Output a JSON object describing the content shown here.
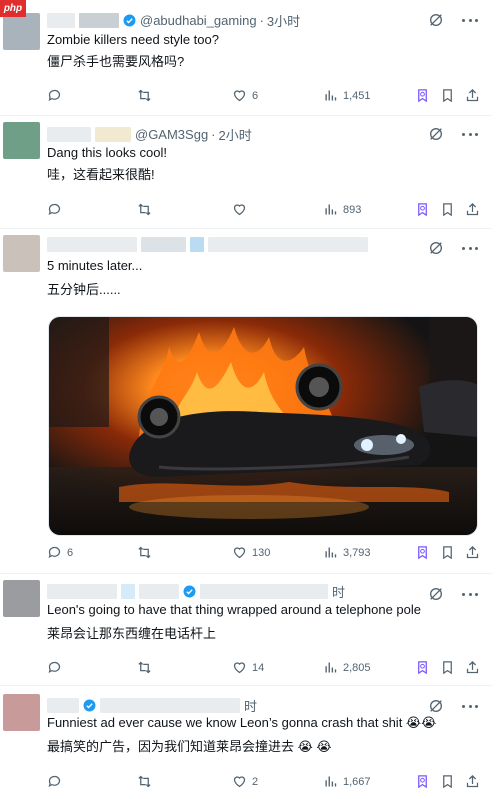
{
  "badge": "php",
  "tweets": [
    {
      "handle": "@abudhabi_gaming",
      "time": "3小时",
      "text_en": "Zombie killers need style too?",
      "text_zh": "僵尸杀手也需要风格吗?",
      "reply_count": "",
      "retweet_count": "",
      "like_count": "6",
      "view_count": "1,451"
    },
    {
      "handle": "@GAM3Sgg",
      "time": "2小时",
      "text_en": "Dang this looks cool!",
      "text_zh": "哇，这看起来很酷!",
      "reply_count": "",
      "retweet_count": "",
      "like_count": "",
      "view_count": "893"
    },
    {
      "handle": "",
      "time": "",
      "text_en": "5 minutes later...",
      "text_zh": "五分钟后......",
      "reply_count": "6",
      "retweet_count": "",
      "like_count": "130",
      "view_count": "3,793",
      "media_alt_icon": "flaming-overturned-car-image"
    },
    {
      "handle": "",
      "time": "时",
      "text_en": "Leon's going to have that thing wrapped around a telephone pole",
      "text_zh": "莱昂会让那东西缠在电话杆上",
      "reply_count": "",
      "retweet_count": "",
      "like_count": "14",
      "view_count": "2,805"
    },
    {
      "handle": "",
      "time": "时",
      "text_en": "Funniest ad ever cause we know Leon’s gonna crash that shit 😭😭",
      "text_zh": "最搞笑的广告，因为我们知道莱昂会撞进去 😭 😭",
      "reply_count": "",
      "retweet_count": "",
      "like_count": "2",
      "view_count": "1,667"
    }
  ],
  "colors": {
    "text": "#0f1419",
    "muted": "#536471",
    "verified": "#1d9bf0",
    "grok": "#7856ff",
    "divider": "#eff3f4"
  }
}
